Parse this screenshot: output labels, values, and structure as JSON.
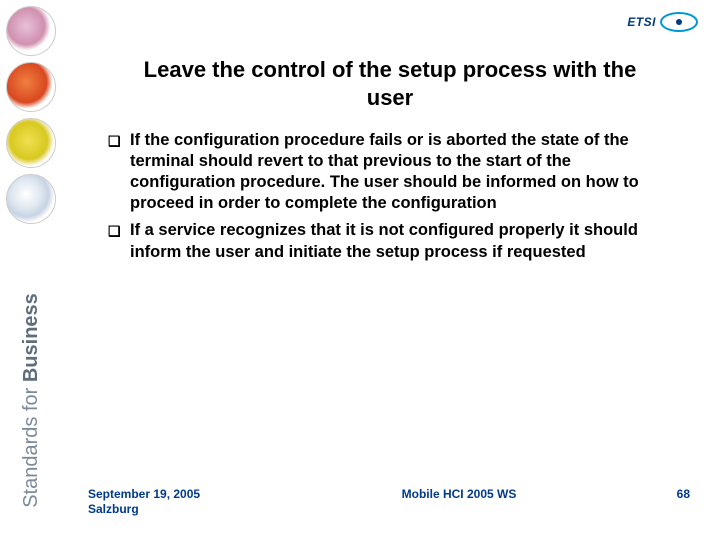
{
  "logo": {
    "text": "ETSI"
  },
  "sidebar": {
    "vertical_text_light": "Standards ",
    "vertical_text_for": "for ",
    "vertical_text_bold": "Business"
  },
  "title": "Leave the control of the setup process with the user",
  "bullets": [
    "If the configuration procedure fails or is aborted the state of the terminal should revert to that previous to the start of the configuration procedure. The user should be informed on how to proceed in order to complete the configuration",
    "If a service recognizes that it is not configured properly it should inform the user and initiate the setup process if requested"
  ],
  "footer": {
    "date": "September 19, 2005",
    "location": "Salzburg",
    "center": "Mobile HCI 2005 WS",
    "page": "68"
  }
}
